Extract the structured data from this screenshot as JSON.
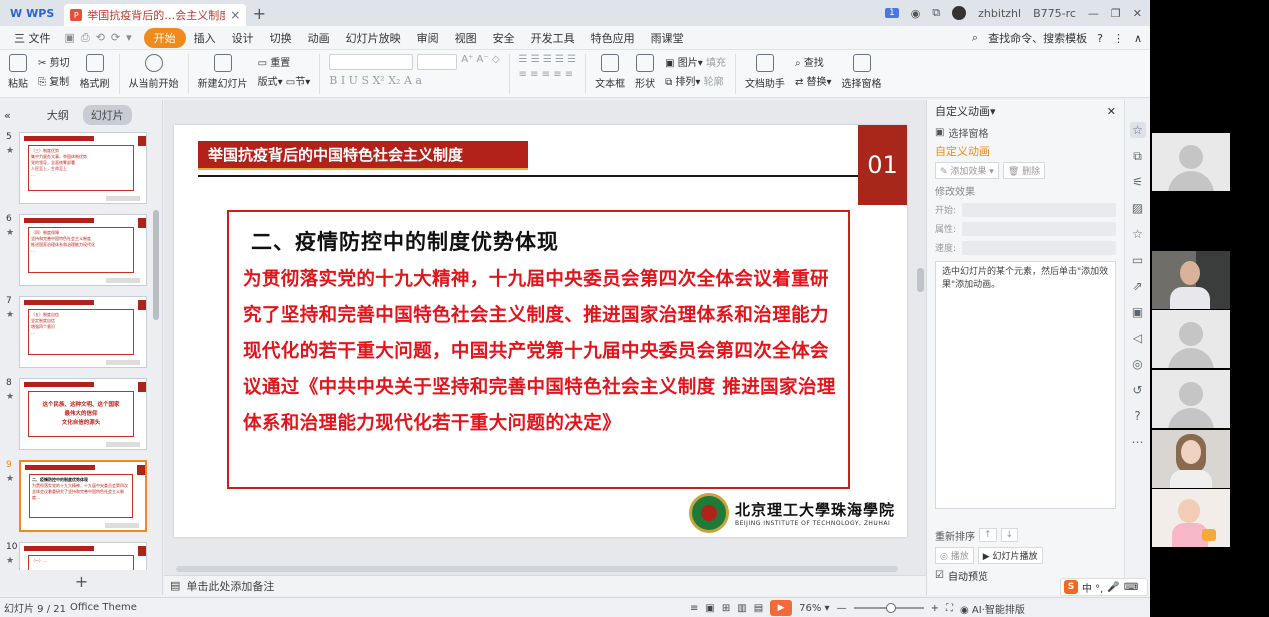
{
  "titlebar": {
    "app_name": "WPS",
    "tab_title": "举国抗疫背后的…会主义制度解读",
    "tab_icon": "P",
    "badge": "1",
    "user": "zhbitzhl",
    "user_suffix": "B775-rc"
  },
  "menu": {
    "file": "三 文件",
    "items": [
      "开始",
      "插入",
      "设计",
      "切换",
      "动画",
      "幻灯片放映",
      "审阅",
      "视图",
      "安全",
      "开发工具",
      "特色应用",
      "雨课堂"
    ],
    "active_index": 0,
    "search": "查找命令、搜索模板"
  },
  "ribbon": {
    "paste": "粘贴",
    "cut": "剪切",
    "copy": "复制",
    "format_painter": "格式刷",
    "from_current": "从当前开始",
    "new_slide": "新建幻灯片",
    "layout": "版式",
    "reset": "重置",
    "section": "节",
    "textbox": "文本框",
    "shape": "形状",
    "picture": "图片",
    "arrange": "排列",
    "fill": "填充",
    "outline": "轮廓",
    "doc_helper": "文档助手",
    "find": "查找",
    "replace": "替换",
    "select_pane": "选择窗格"
  },
  "left_panel": {
    "tab_outline": "大纲",
    "tab_slides": "幻灯片",
    "thumbs": [
      {
        "num": "5",
        "lines": [
          "（三）制度优势",
          "集中力量办大事，举国体制优势",
          "党的领导，全面统筹部署",
          "人民至上，生命至上",
          "…"
        ]
      },
      {
        "num": "6",
        "lines": [
          "（四）制度保障",
          "坚持和完善中国特色社会主义制度",
          "推进国家治理体系和治理能力现代化",
          "…"
        ]
      },
      {
        "num": "7",
        "lines": [
          "（五）制度自信",
          "坚定制度自信",
          "增强四个意识",
          "…"
        ]
      },
      {
        "num": "8",
        "lines": [
          "这个民族、这种文明、这个国家",
          "最伟大的信仰",
          "文化自信的源头"
        ]
      },
      {
        "num": "9",
        "lines": [
          "二、疫情防控中的制度优势体现",
          "为贯彻落实党的十九大精神，十九届中央委员会第四次全体会议着重研究了坚持和完善中国特色社会主义制度…"
        ]
      },
      {
        "num": "10",
        "lines": [
          "（一）…"
        ]
      }
    ]
  },
  "slide": {
    "title": "举国抗疫背后的中国特色社会主义制度",
    "number": "01",
    "heading": "二、疫情防控中的制度优势体现",
    "body": "为贯彻落实党的十九大精神，十九届中央委员会第四次全体会议着重研究了坚持和完善中国特色社会主义制度、推进国家治理体系和治理能力现代化的若干重大问题，中国共产党第十九届中央委员会第四次全体会议通过《中共中央关于坚持和完善中国特色社会主义制度 推进国家治理体系和治理能力现代化若干重大问题的决定》",
    "uni_cn": "北京理工大學珠海學院",
    "uni_en": "BEIJING INSTITUTE OF TECHNOLOGY, ZHUHAI"
  },
  "notes": {
    "placeholder": "单击此处添加备注"
  },
  "right_panel": {
    "title": "自定义动画",
    "select_pane": "选择窗格",
    "custom_anim": "自定义动画",
    "add_effect": "添加效果",
    "delete": "删除",
    "modify": "修改效果",
    "start": "开始:",
    "property": "属性:",
    "speed": "速度:",
    "hint": "选中幻灯片的某个元素，然后单击\"添加效果\"添加动画。",
    "reorder": "重新排序",
    "play": "播放",
    "slideshow": "幻灯片播放",
    "auto_preview": "自动预览"
  },
  "status": {
    "slide_pos": "幻灯片 9 / 21",
    "theme": "Office Theme",
    "zoom": "76%",
    "ai": "AI·智能排版"
  },
  "ime": {
    "label": "中 °,"
  }
}
